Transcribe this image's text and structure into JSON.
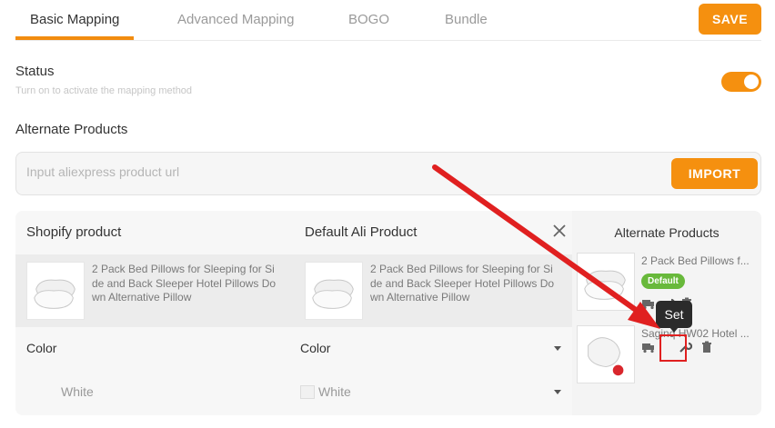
{
  "tabs": [
    {
      "label": "Basic Mapping",
      "active": true
    },
    {
      "label": "Advanced Mapping",
      "active": false
    },
    {
      "label": "BOGO",
      "active": false
    },
    {
      "label": "Bundle",
      "active": false
    }
  ],
  "toolbar": {
    "save_label": "SAVE"
  },
  "status": {
    "title": "Status",
    "subtitle": "Turn on to activate the mapping method",
    "enabled": true
  },
  "alternate_section": {
    "title": "Alternate Products"
  },
  "url_input": {
    "placeholder": "Input aliexpress product url",
    "value": ""
  },
  "import_label": "IMPORT",
  "mapping": {
    "shopify_header": "Shopify product",
    "default_header": "Default Ali Product",
    "shopify_product": {
      "name": "2 Pack Bed Pillows for Sleeping for Si de and Back Sleeper Hotel Pillows Do wn Alternative Pillow"
    },
    "default_product": {
      "name": "2 Pack Bed Pillows for Sleeping for Si de and Back Sleeper Hotel Pillows Do wn Alternative Pillow"
    },
    "option_name_left": "Color",
    "option_name_right": "Color",
    "option_value_left": "White",
    "option_value_right": "White"
  },
  "alternate_panel": {
    "title": "Alternate Products",
    "items": [
      {
        "name": "2 Pack Bed Pillows f...",
        "badge": "Default"
      },
      {
        "name": "Saginq HW02 Hotel ...",
        "badge": ""
      }
    ]
  },
  "tooltip": {
    "text": "Set"
  },
  "colors": {
    "accent": "#f5900f",
    "badge_green": "#68b93b",
    "annotation_red": "#e02020"
  },
  "icons": [
    "close-icon",
    "truck-icon",
    "wrench-icon",
    "trash-icon",
    "chevron-down-icon"
  ]
}
